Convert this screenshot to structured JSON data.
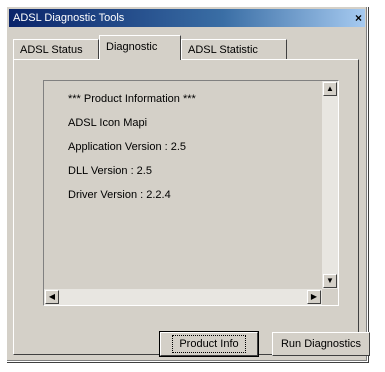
{
  "window": {
    "title": "ADSL Diagnostic Tools",
    "close_glyph": "×"
  },
  "tabs": [
    {
      "label": "ADSL Status",
      "selected": false
    },
    {
      "label": "Diagnostic",
      "selected": true
    },
    {
      "label": "ADSL Statistic",
      "selected": false
    }
  ],
  "listbox": {
    "lines": [
      "*** Product Information ***",
      "ADSL Icon Mapi",
      "Application Version : 2.5",
      "DLL Version : 2.5",
      "Driver Version : 2.2.4"
    ],
    "scroll_up_icon": "▲",
    "scroll_down_icon": "▼",
    "scroll_left_icon": "◀",
    "scroll_right_icon": "▶"
  },
  "buttons": {
    "product_info": "Product Info",
    "run_diagnostics": "Run Diagnostics"
  }
}
